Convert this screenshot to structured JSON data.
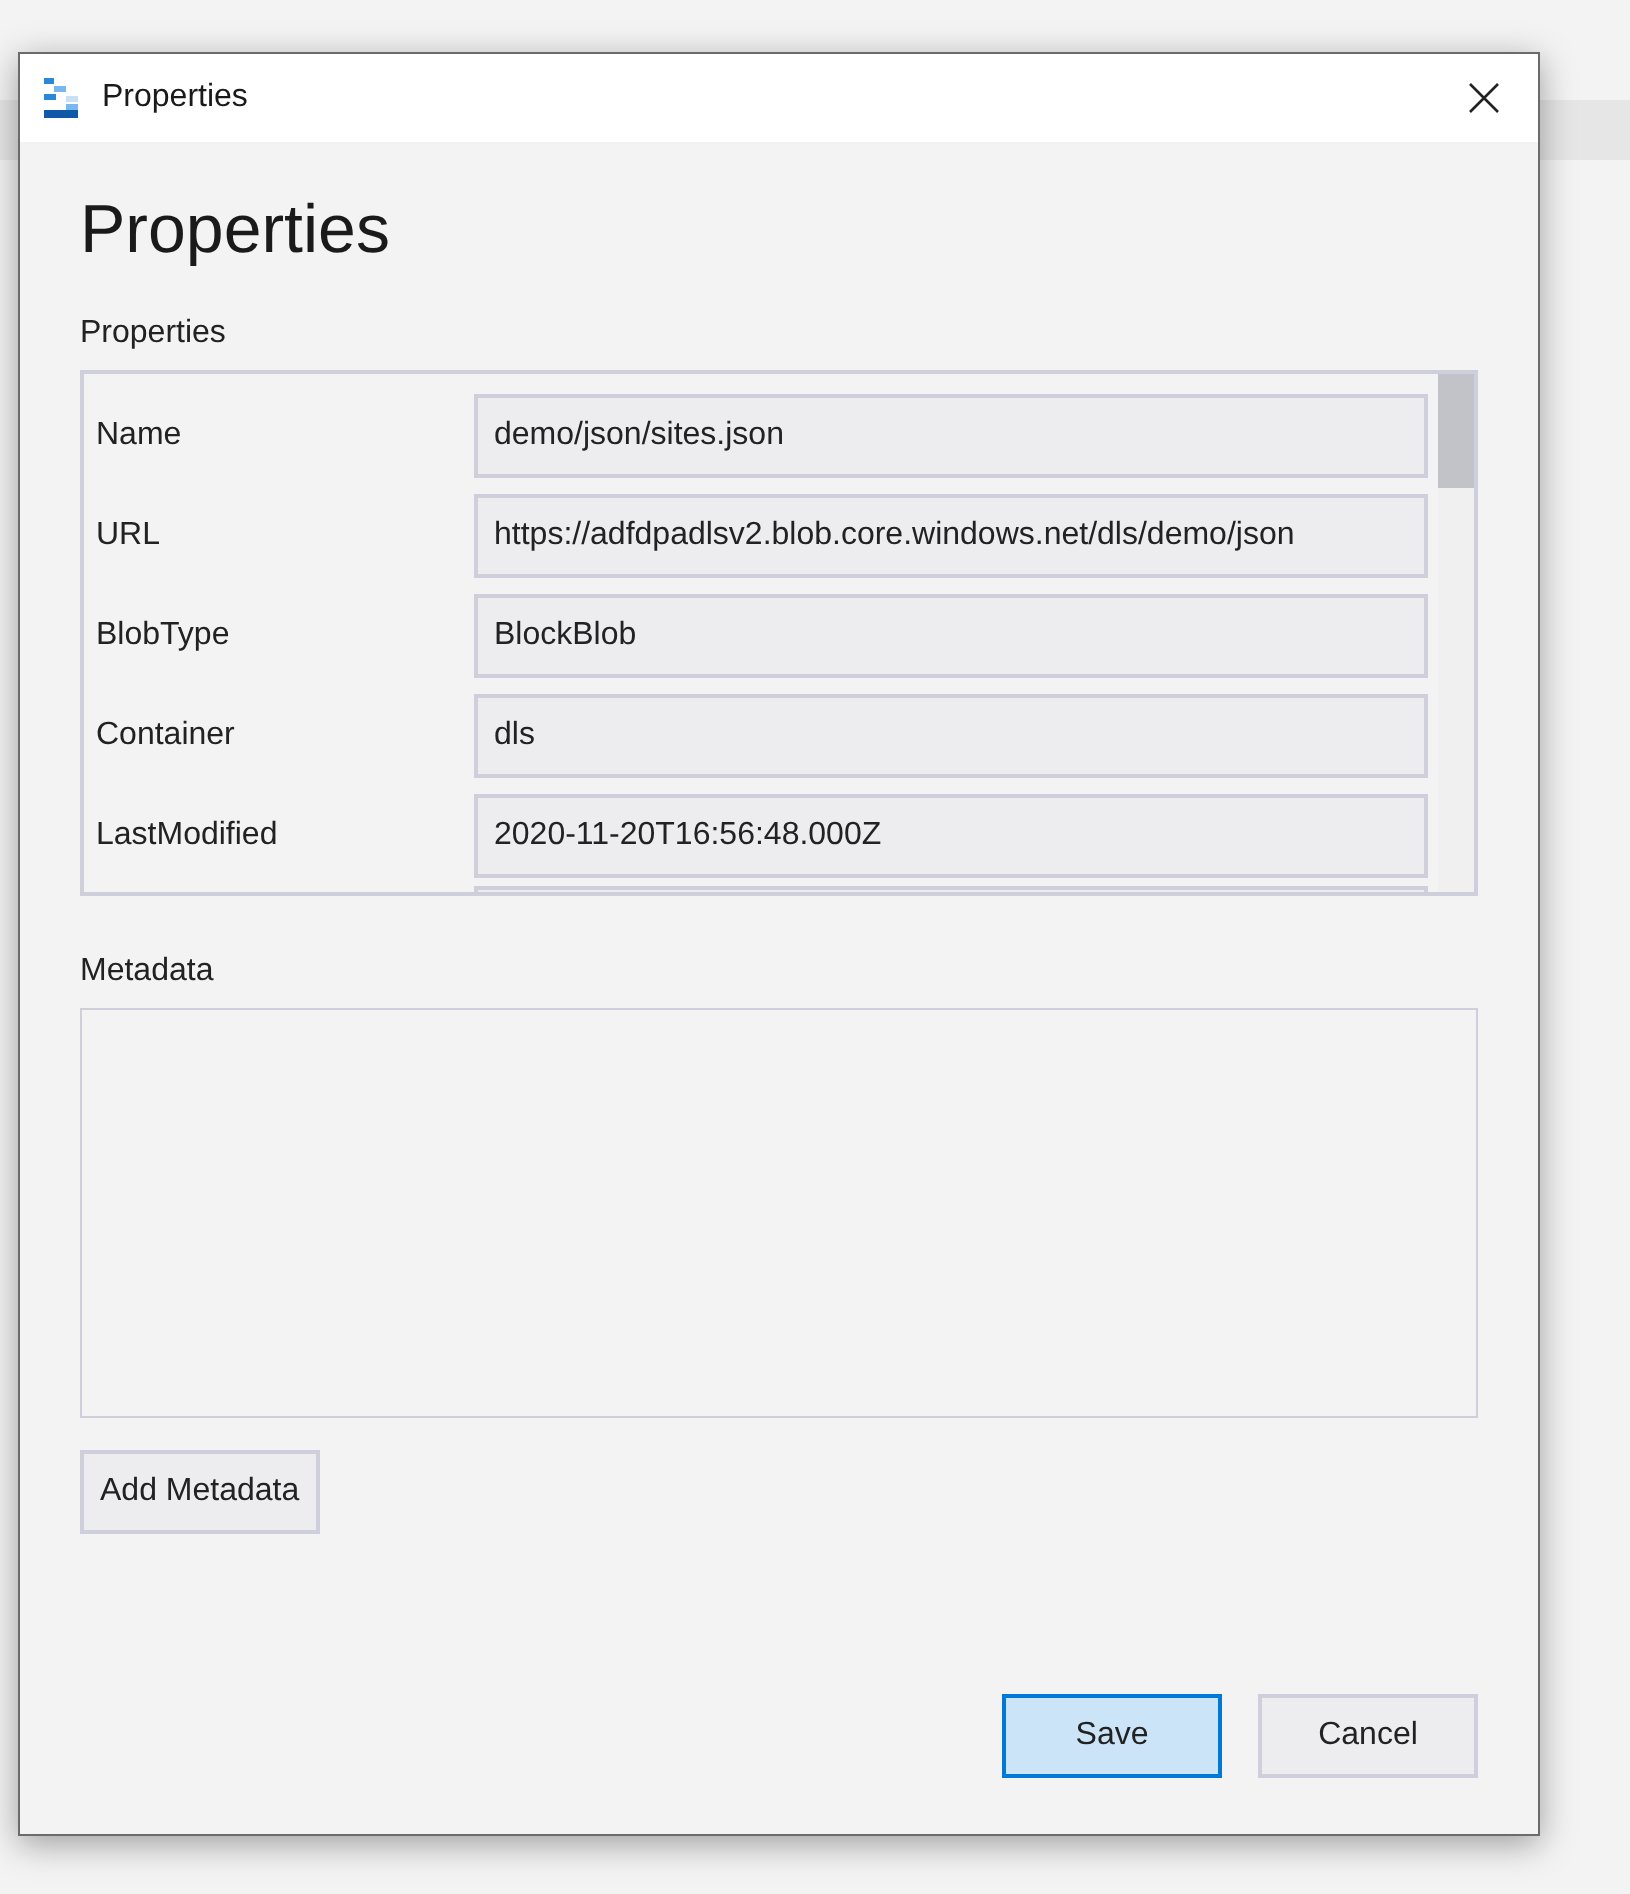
{
  "window": {
    "title": "Properties"
  },
  "heading": "Properties",
  "properties": {
    "label": "Properties",
    "rows": [
      {
        "name": "Name",
        "value": "demo/json/sites.json"
      },
      {
        "name": "URL",
        "value": "https://adfdpadlsv2.blob.core.windows.net/dls/demo/json"
      },
      {
        "name": "BlobType",
        "value": "BlockBlob"
      },
      {
        "name": "Container",
        "value": "dls"
      },
      {
        "name": "LastModified",
        "value": "2020-11-20T16:56:48.000Z"
      }
    ]
  },
  "metadata": {
    "label": "Metadata",
    "add_button": "Add Metadata"
  },
  "buttons": [
    {
      "label": "Save",
      "default": true
    },
    {
      "label": "Cancel",
      "default": false
    }
  ]
}
